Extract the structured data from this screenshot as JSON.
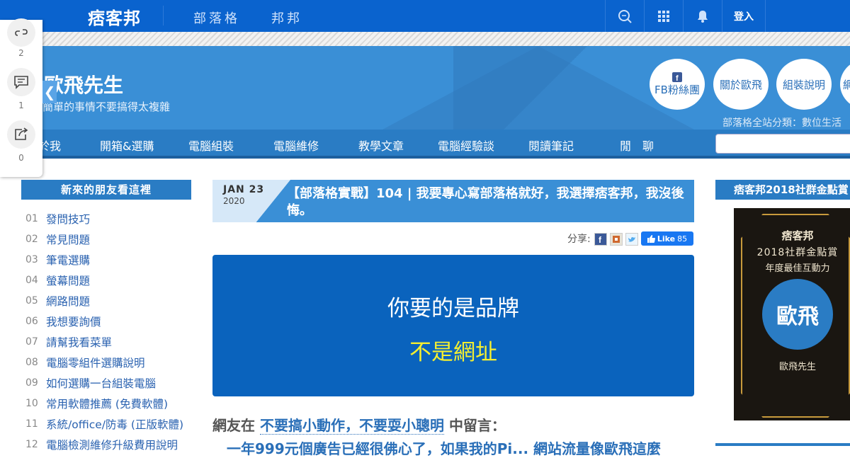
{
  "topbar": {
    "logo": "痞客邦",
    "nav": [
      "部落格",
      "邦邦"
    ],
    "icons": [
      "search-icon",
      "apps-grid-icon",
      "bell-icon"
    ],
    "login_label": "登入",
    "color": "#0a63ce"
  },
  "banner": {
    "title": "歐飛先生",
    "subtitle": "簡單的事情不要搞得太複雜",
    "circles": [
      "FB粉絲團",
      "關於歐飛",
      "組裝說明",
      "網"
    ],
    "category": "部落格全站分類：數位生活"
  },
  "share_bar": {
    "counts": [
      "2",
      "1",
      "0"
    ],
    "icons": [
      "link-icon",
      "comment-icon",
      "share-icon"
    ],
    "collapse_glyph": "❮"
  },
  "nav": {
    "items": [
      "關於我",
      "開箱&選購",
      "電腦組裝",
      "電腦維修",
      "教學文章",
      "電腦經驗談",
      "閱讀筆記",
      "閒　聊"
    ]
  },
  "left_sidebar": {
    "heading": "新來的朋友看這裡",
    "items": [
      {
        "num": "01",
        "label": "發問技巧"
      },
      {
        "num": "02",
        "label": "常見問題"
      },
      {
        "num": "03",
        "label": "筆電選購"
      },
      {
        "num": "04",
        "label": "螢幕問題"
      },
      {
        "num": "05",
        "label": "網路問題"
      },
      {
        "num": "06",
        "label": "我想要詢價"
      },
      {
        "num": "07",
        "label": "請幫我看菜單"
      },
      {
        "num": "08",
        "label": "電腦零組件選購說明"
      },
      {
        "num": "09",
        "label": "如何選購一台組裝電腦"
      },
      {
        "num": "10",
        "label": "常用軟體推薦 (免費軟體)"
      },
      {
        "num": "11",
        "label": "系統/office/防毒 (正版軟體)"
      },
      {
        "num": "12",
        "label": "電腦檢測維修升級費用說明"
      }
    ]
  },
  "post": {
    "date": "JAN 23",
    "year": "2020",
    "title": "【部落格實戰】104 | 我要專心寫部落格就好，我選擇痞客邦，我沒後悔。",
    "share_label": "分享:",
    "like_label": "Like",
    "like_count": "85",
    "hero_line1": "你要的是品牌",
    "hero_line2": "不是網址",
    "comment_prefix": "網友在",
    "comment_link": "不要搞小動作，不要耍小聰明",
    "comment_suffix": "中留言：",
    "cut_text": "一年999元個廣告已經很佛心了，如果我的Pi... 網站流量像歐飛這麼"
  },
  "right_sidebar": {
    "heading": "痞客邦2018社群金點賞",
    "award_brand": "痞客邦",
    "award_title": "2018社群金點賞",
    "award_sub": "年度最佳互動力",
    "award_name": "歐飛",
    "award_footer": "歐飛先生"
  }
}
